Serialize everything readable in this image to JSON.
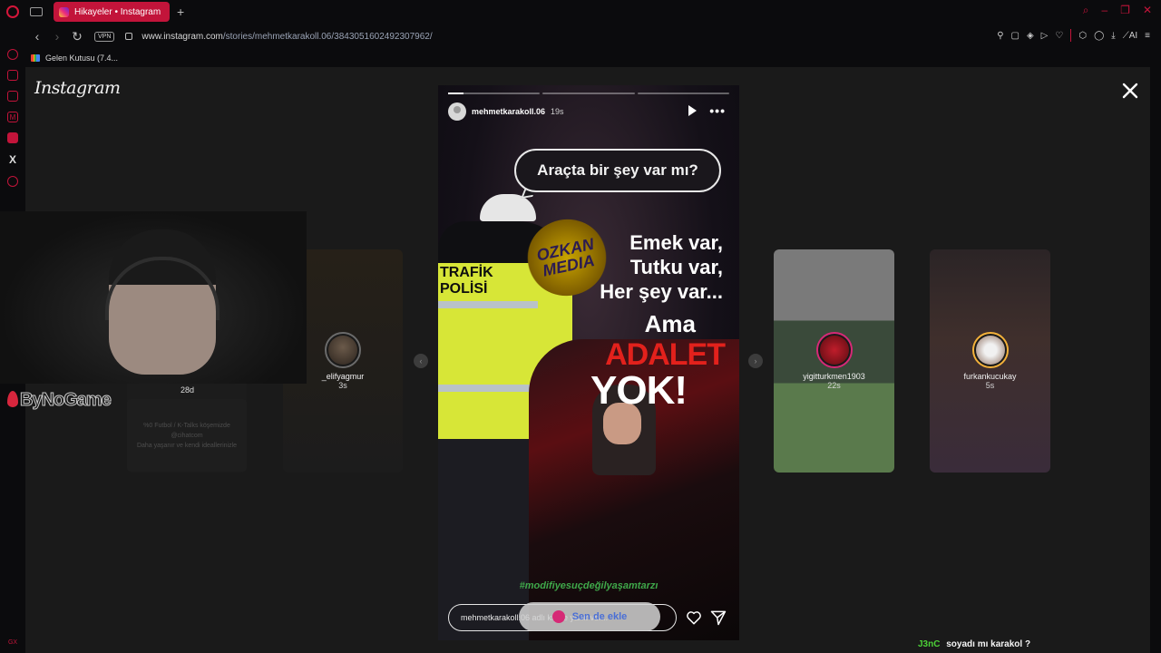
{
  "browser": {
    "tab_title": "Hikayeler • Instagram",
    "url_host": "www.instagram.com",
    "url_path": "/stories/mehmetkarakoll.06/3843051602492307962/",
    "vpn_label": "VPN",
    "bookmark_gmail": "Gelen Kutusu (7.4...",
    "ai_label": "AI",
    "sidebar_bottom": "GX"
  },
  "instagram": {
    "logo": "Instagram"
  },
  "left_previews": {
    "ghost_user_age": "28d",
    "ghost_card_line1": "%0 Futbol / K-Talks köşemizde",
    "ghost_card_line2": "@cihatcom",
    "ghost_card_line3": "Daha yaşanır ve kendi ideallerinizle",
    "elif": {
      "username": "_elifyagmur",
      "age": "3s"
    }
  },
  "right_previews": [
    {
      "username": "yigitturkmen1903",
      "age": "22s",
      "bg": "#59714c"
    },
    {
      "username": "furkankucukay",
      "age": "5s",
      "bg": "#3a2c3a"
    }
  ],
  "story": {
    "username": "mehmetkarakoll.06",
    "time": "19s",
    "progress_segments": 3,
    "progress_current_fraction": 0.17,
    "bubble_text": "Araçta bir şey var mı?",
    "media_text": "OZKAN MEDIA",
    "slogan_line1": "Emek var,",
    "slogan_line2": "Tutku var,",
    "slogan_line3": "Her şey var...",
    "ama": "Ama",
    "adalet": "ADALET",
    "yok": "YOK!",
    "officer_line1": "TRAFİK",
    "officer_line2": "POLİSİ",
    "hashtag": "#modifiyesuçdeğilyaşamtarzı",
    "reply_placeholder": "mehmetkarakoll.06 adlı kişiye yanıt ver...",
    "add_to_story_label": "Sen de ekle"
  },
  "overlay": {
    "brand": "ByNoGame"
  },
  "chat": {
    "user": "J3nC",
    "message": "soyadı mı karakol ?"
  },
  "colors": {
    "opera_red": "#c2143a",
    "ig_gradient_pink": "#d62976",
    "chat_user": "#4cd137"
  }
}
